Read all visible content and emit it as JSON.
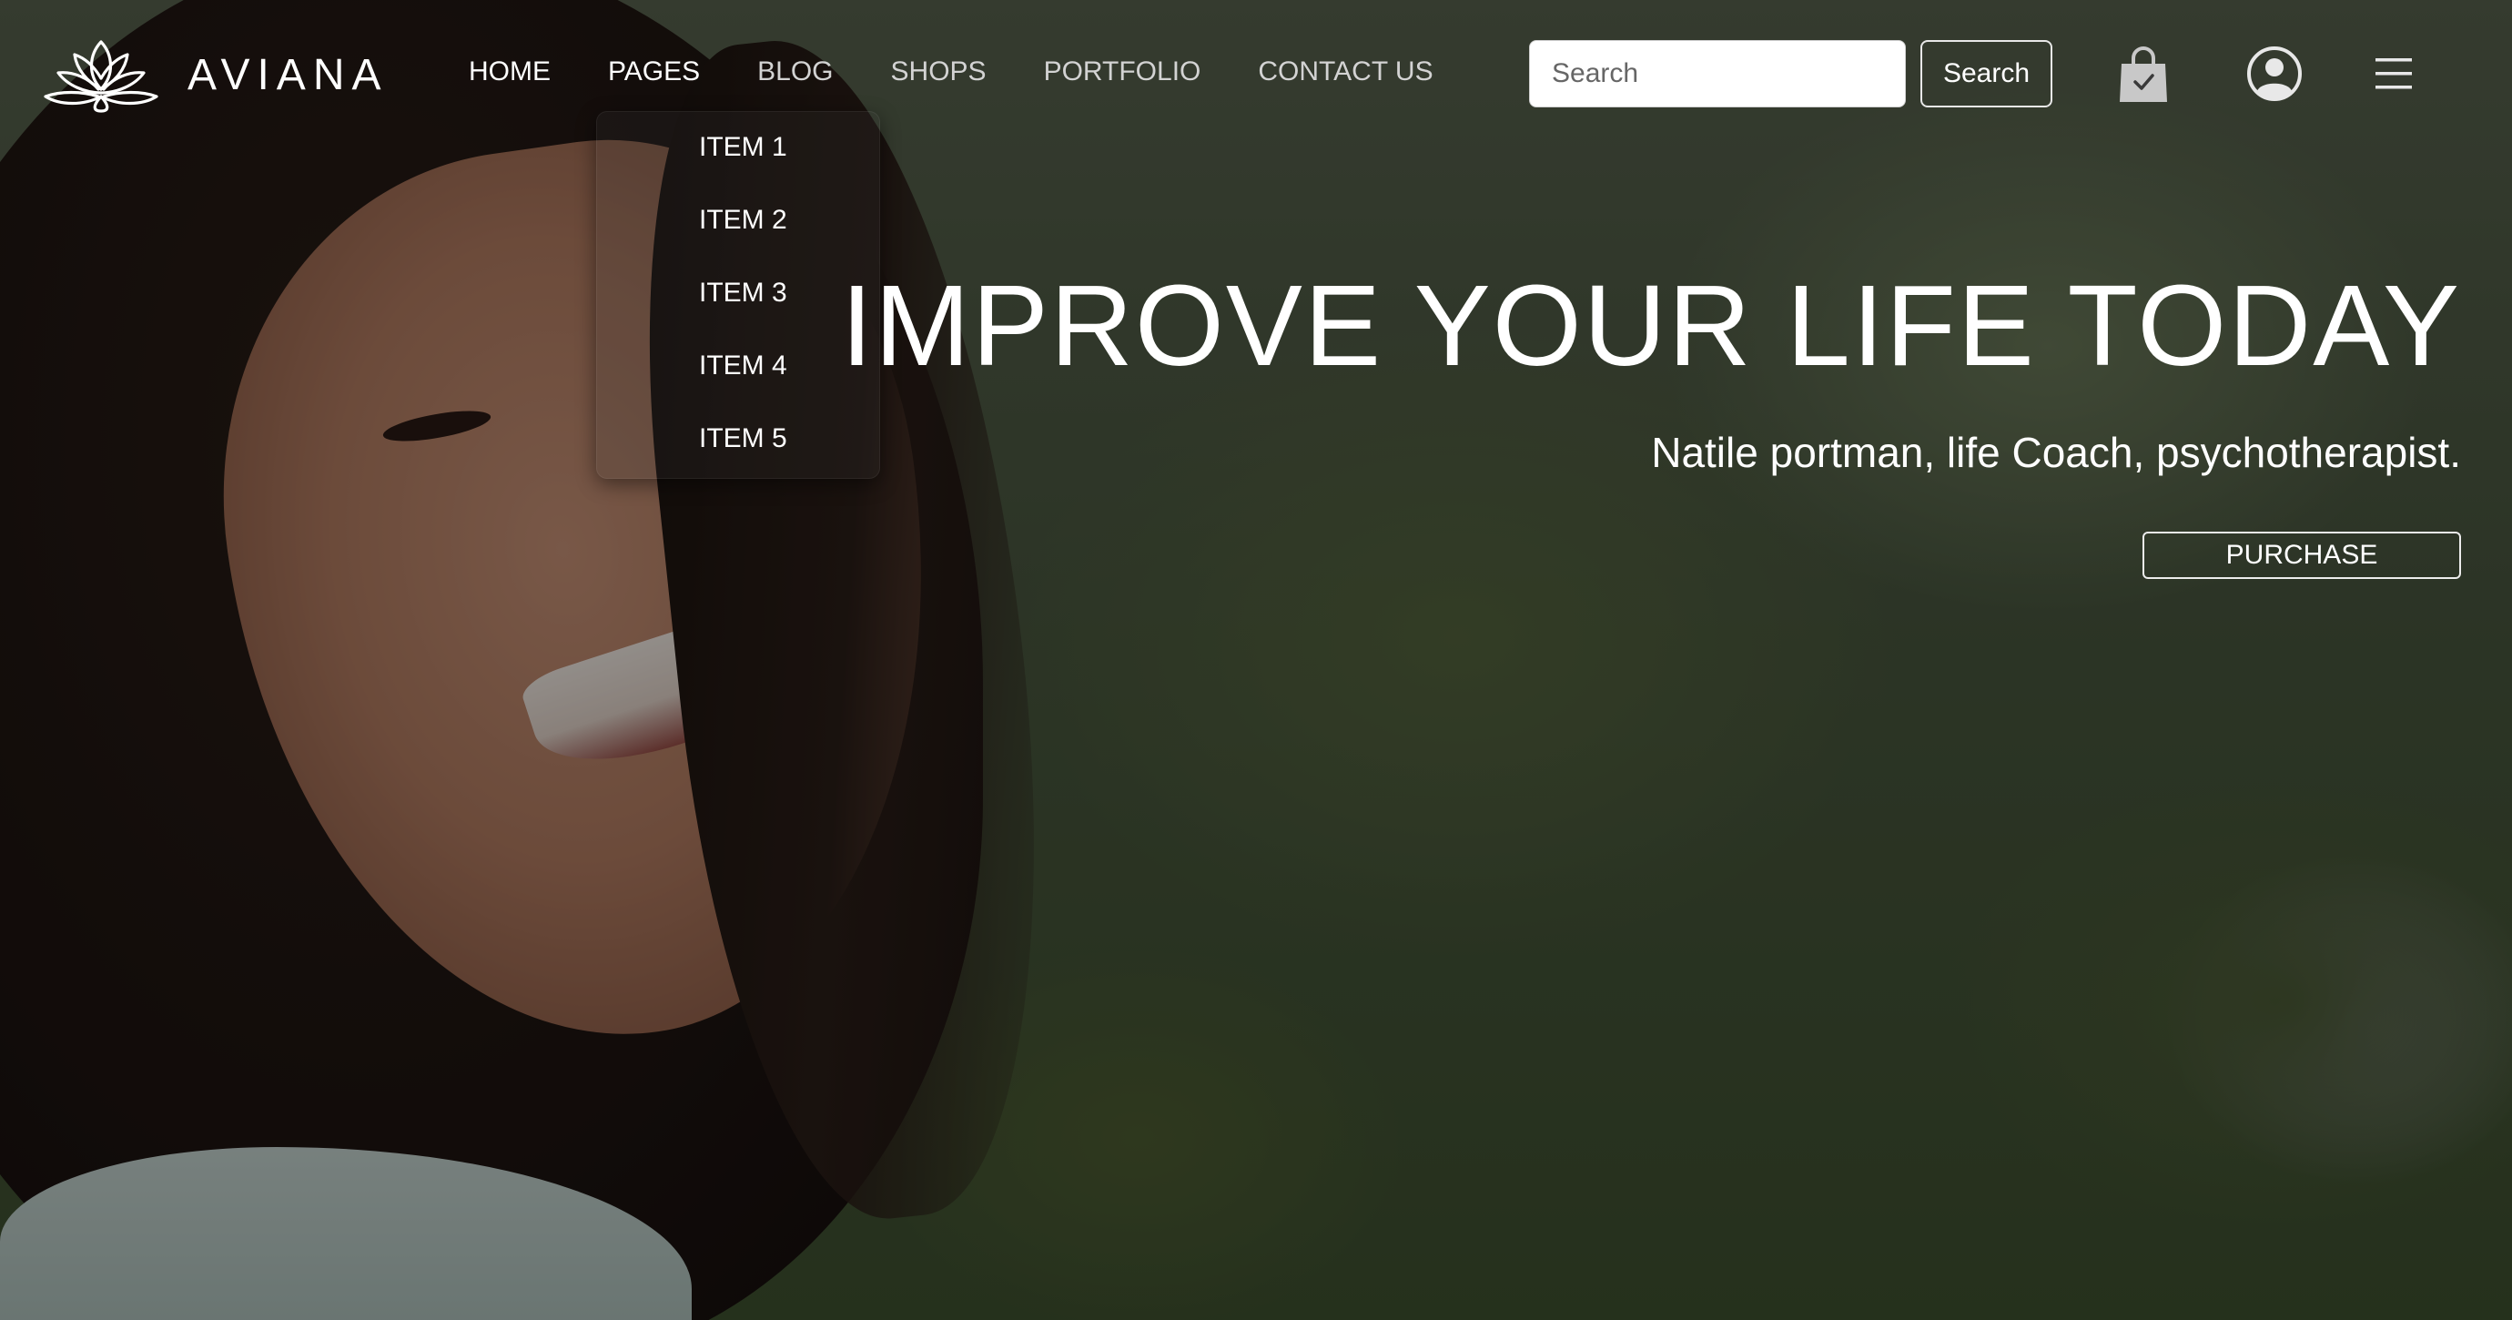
{
  "brand": {
    "name": "AVIANA",
    "logo_icon": "lotus-icon"
  },
  "nav": {
    "items": [
      {
        "label": "HOME",
        "state": "active"
      },
      {
        "label": "PAGES",
        "state": "open"
      },
      {
        "label": "BLOG",
        "state": "default"
      },
      {
        "label": "SHOPS",
        "state": "default"
      },
      {
        "label": "PORTFOLIO",
        "state": "default"
      },
      {
        "label": "CONTACT US",
        "state": "default"
      }
    ]
  },
  "search": {
    "placeholder": "Search",
    "value": "",
    "button_label": "Search"
  },
  "icons": {
    "cart": "shopping-bag-icon",
    "account": "user-circle-icon",
    "menu": "hamburger-menu-icon"
  },
  "dropdown": {
    "parent": "PAGES",
    "items": [
      "ITEM 1",
      "ITEM 2",
      "ITEM 3",
      "ITEM 4",
      "ITEM 5"
    ]
  },
  "hero": {
    "title": "IMPROVE YOUR LIFE TODAY",
    "subtitle": "Natile portman, life Coach, psychotherapist.",
    "cta_label": "PURCHASE"
  },
  "colors": {
    "text_primary": "#ffffff",
    "nav_inactive": "#d3d3d3",
    "overlay": "rgba(0,0,0,0.40)",
    "bag_icon": "#c8c8c8"
  }
}
